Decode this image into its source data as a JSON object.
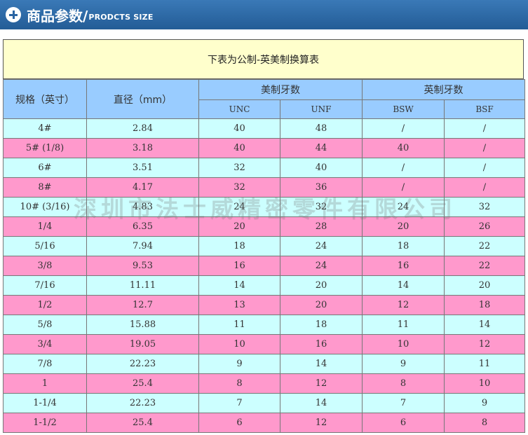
{
  "header": {
    "title": "商品参数/",
    "subtitle": "PRODCTS SIZE"
  },
  "caption": "下表为公制-英美制换算表",
  "table": {
    "col_spec": "规格（英寸）",
    "col_diameter": "直径（mm）",
    "group_us": "美制牙数",
    "group_uk": "英制牙数",
    "sub_headers": [
      "UNC",
      "UNF",
      "BSW",
      "BSF"
    ],
    "rows": [
      [
        "4#",
        "2.84",
        "40",
        "48",
        "/",
        "/"
      ],
      [
        "5# (1/8)",
        "3.18",
        "40",
        "44",
        "40",
        "/"
      ],
      [
        "6#",
        "3.51",
        "32",
        "40",
        "/",
        "/"
      ],
      [
        "8#",
        "4.17",
        "32",
        "36",
        "/",
        "/"
      ],
      [
        "10# (3/16)",
        "4.83",
        "24",
        "32",
        "24",
        "32"
      ],
      [
        "1/4",
        "6.35",
        "20",
        "28",
        "20",
        "26"
      ],
      [
        "5/16",
        "7.94",
        "18",
        "24",
        "18",
        "22"
      ],
      [
        "3/8",
        "9.53",
        "16",
        "24",
        "16",
        "22"
      ],
      [
        "7/16",
        "11.11",
        "14",
        "20",
        "14",
        "20"
      ],
      [
        "1/2",
        "12.7",
        "13",
        "20",
        "12",
        "18"
      ],
      [
        "5/8",
        "15.88",
        "11",
        "18",
        "11",
        "14"
      ],
      [
        "3/4",
        "19.05",
        "10",
        "16",
        "10",
        "12"
      ],
      [
        "7/8",
        "22.23",
        "9",
        "14",
        "9",
        "11"
      ],
      [
        "1",
        "25.4",
        "8",
        "12",
        "8",
        "10"
      ],
      [
        "1-1/4",
        "22.23",
        "7",
        "14",
        "7",
        "9"
      ],
      [
        "1-1/2",
        "25.4",
        "6",
        "12",
        "6",
        "8"
      ]
    ]
  },
  "watermark": "深圳市法士威精密零件有限公司",
  "colors": {
    "header_bg": "#2a65a3",
    "caption_bg": "#ffffcc",
    "table_header_bg": "#99ccff",
    "row_cyan": "#ccffff",
    "row_pink": "#ff99cc"
  }
}
